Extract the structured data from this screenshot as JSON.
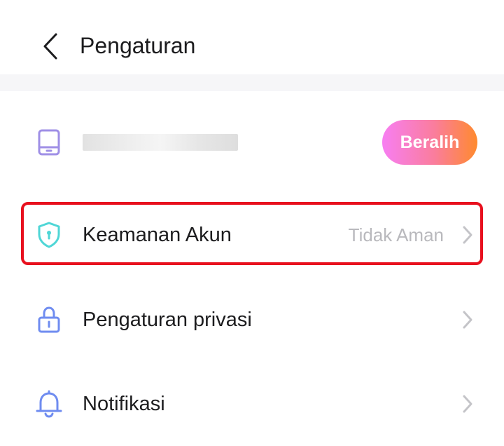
{
  "header": {
    "title": "Pengaturan"
  },
  "account": {
    "switch_label": "Beralih"
  },
  "menu": {
    "items": [
      {
        "label": "Keamanan Akun",
        "value": "Tidak Aman",
        "icon": "shield-icon",
        "color": "#4fd6d6"
      },
      {
        "label": "Pengaturan privasi",
        "value": "",
        "icon": "lock-icon",
        "color": "#6f8cf0"
      },
      {
        "label": "Notifikasi",
        "value": "",
        "icon": "bell-icon",
        "color": "#6f8cf0"
      }
    ]
  },
  "colors": {
    "highlight": "#e8101e",
    "account_icon": "#9f8fe6",
    "value_text": "#b9b9bd",
    "chevron": "#c4c4c8"
  }
}
